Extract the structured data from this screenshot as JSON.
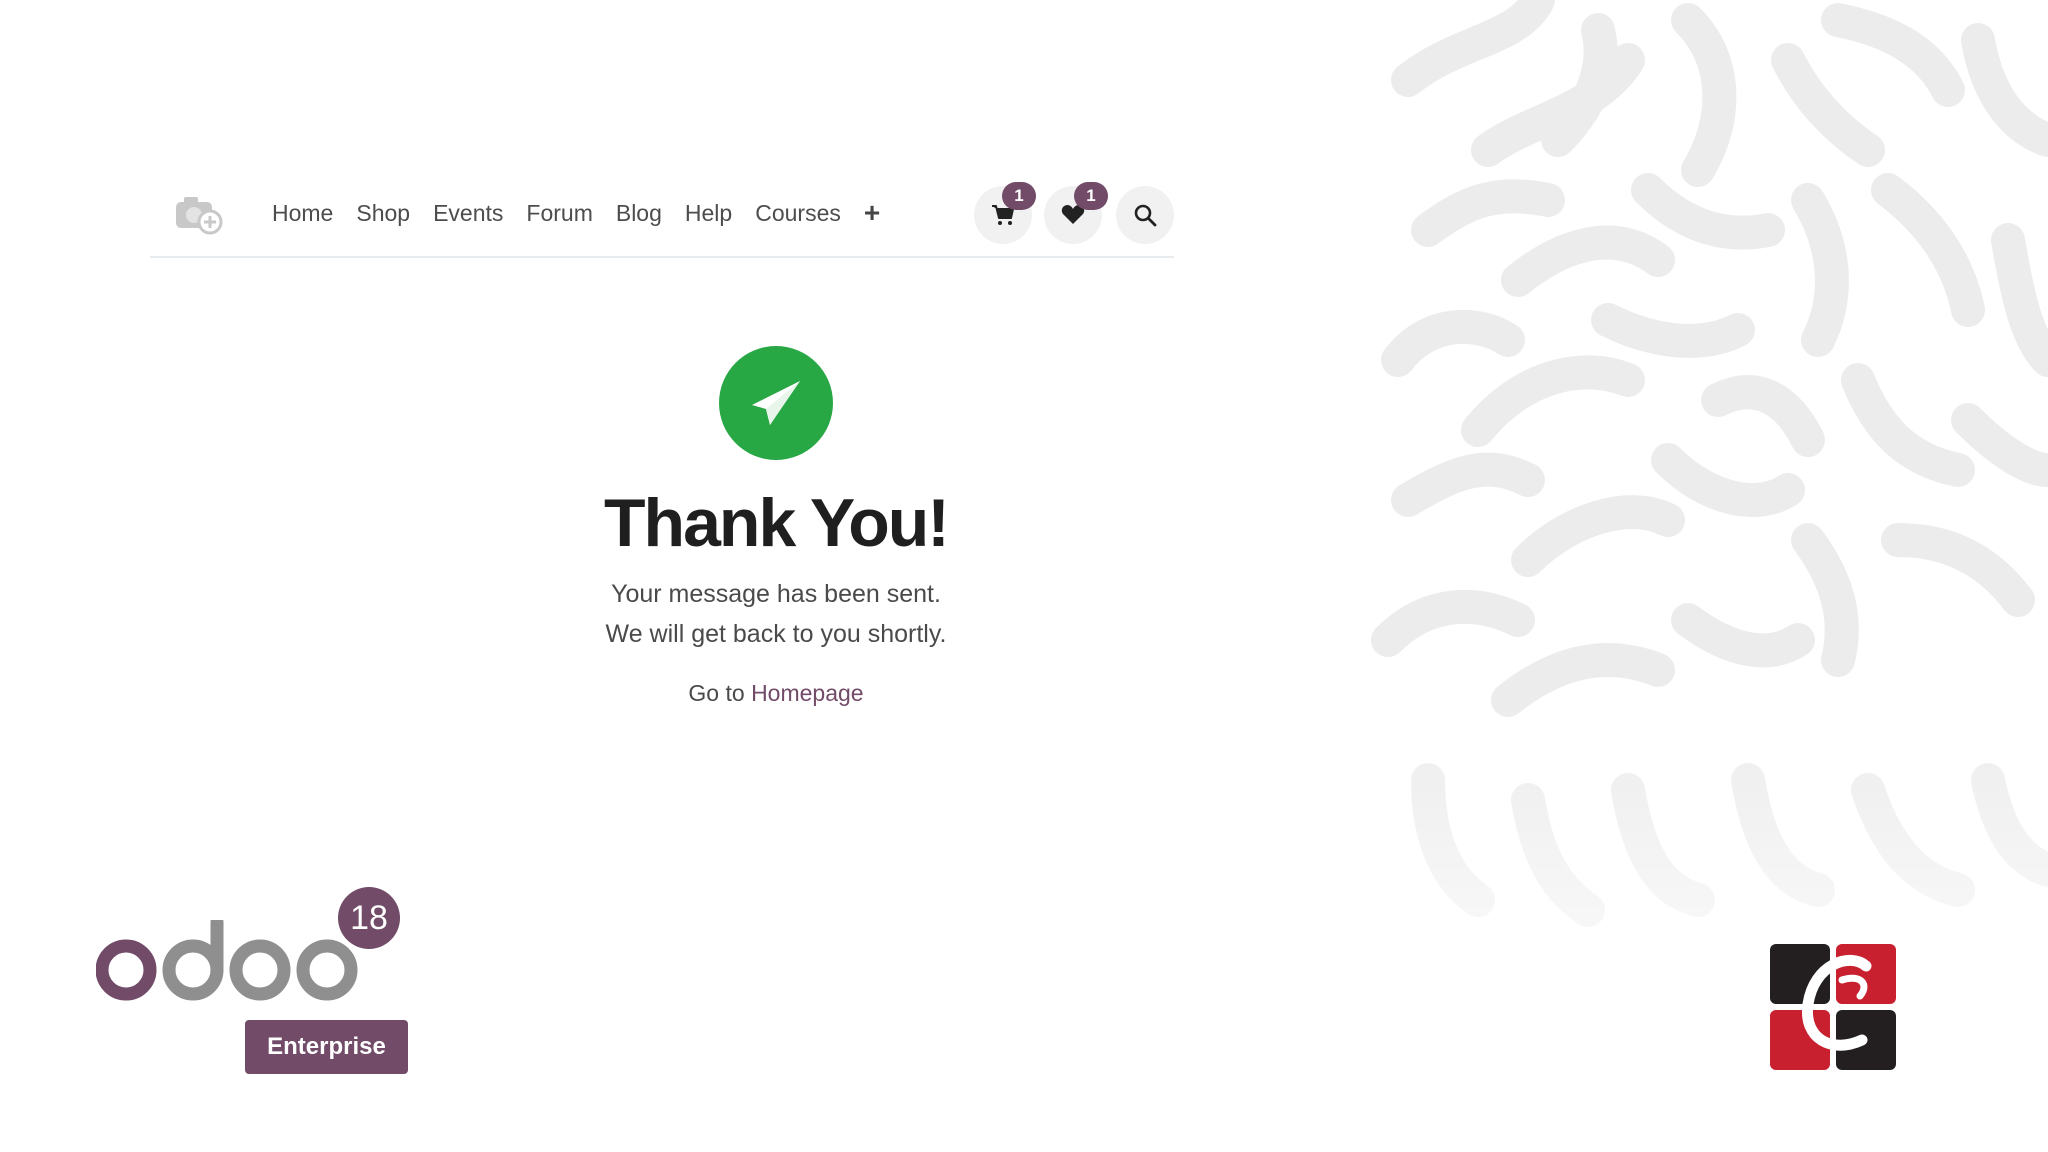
{
  "navbar": {
    "menu": [
      {
        "label": "Home"
      },
      {
        "label": "Shop"
      },
      {
        "label": "Events"
      },
      {
        "label": "Forum"
      },
      {
        "label": "Blog"
      },
      {
        "label": "Help"
      },
      {
        "label": "Courses"
      }
    ],
    "add_label": "+",
    "cart_count": "1",
    "wishlist_count": "1",
    "icons": {
      "logo": "camera-plus-icon",
      "cart": "shopping-cart-icon",
      "wishlist": "heart-icon",
      "search": "search-icon"
    }
  },
  "confirmation": {
    "icon": "paper-plane-icon",
    "title": "Thank You!",
    "line1": "Your message has been sent.",
    "line2": "We will get back to you shortly.",
    "link_prefix": "Go to ",
    "link_text": "Homepage"
  },
  "branding": {
    "version": "18",
    "edition": "Enterprise"
  },
  "colors": {
    "brand": "#714b67",
    "success": "#28a745",
    "pattern": "#efefef"
  }
}
